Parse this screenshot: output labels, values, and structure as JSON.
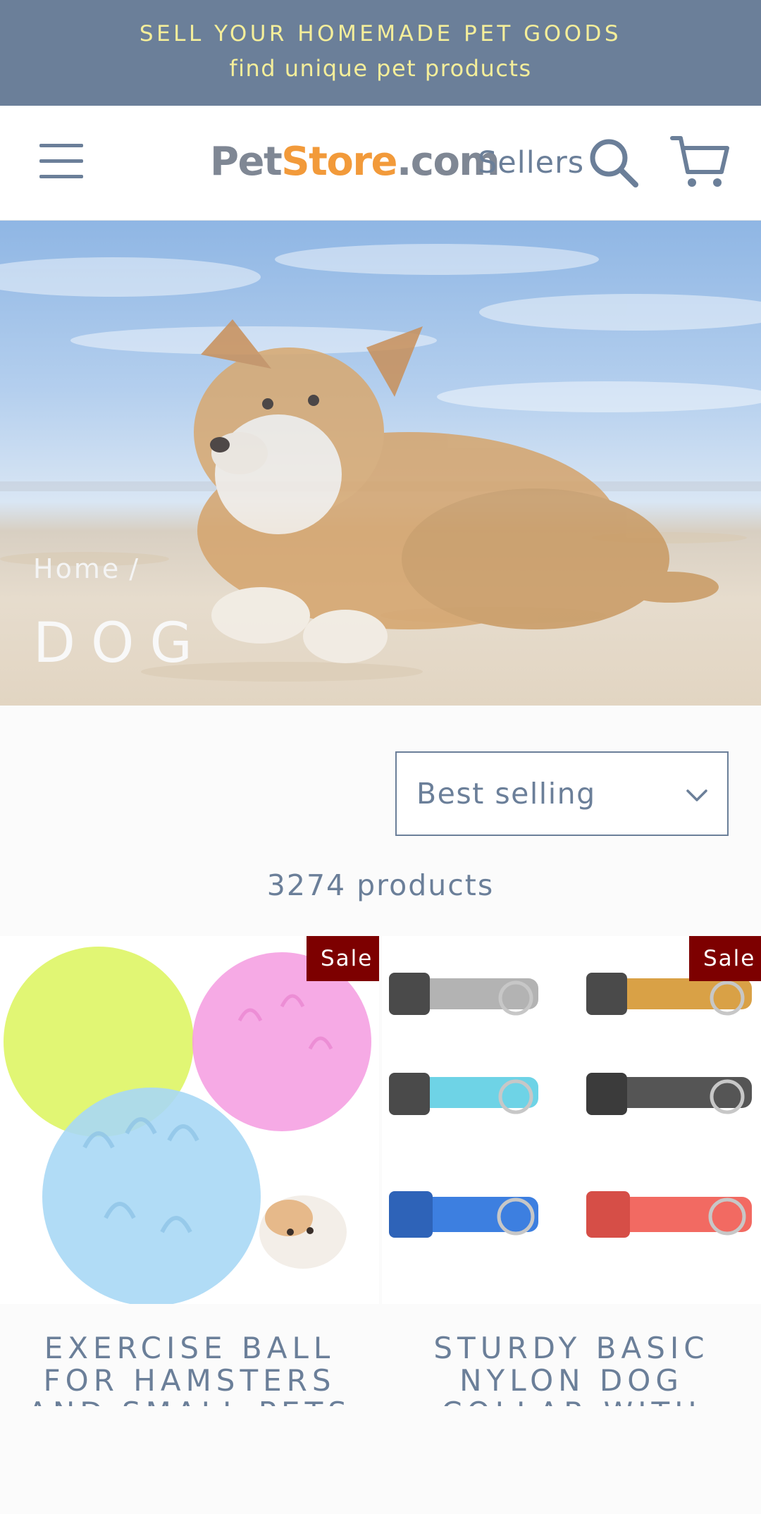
{
  "announcement": {
    "line1": "SELL YOUR HOMEMADE PET GOODS",
    "line2": "find unique pet products"
  },
  "header": {
    "logo_pet": "Pet",
    "logo_store": "Store",
    "logo_dotcom": ".com",
    "sellers_label": "Sellers",
    "icons": [
      "menu-icon",
      "search-icon",
      "cart-icon"
    ]
  },
  "hero": {
    "breadcrumb_home": "Home",
    "breadcrumb_sep": "/",
    "title": "DOG"
  },
  "sort": {
    "selected": "Best selling"
  },
  "product_count": "3274 products",
  "products": [
    {
      "name": "EXERCISE BALL FOR HAMSTERS AND SMALL PETS",
      "badge": "Sale"
    },
    {
      "name": "STURDY BASIC NYLON DOG COLLAR WITH",
      "badge": "Sale"
    }
  ],
  "colors": {
    "announcement_bg": "#6b7f99",
    "announcement_text": "#f4ee9a",
    "brand_text": "#6b7f99",
    "logo_accent": "#f29a3a",
    "sale_badge": "#7d0000"
  }
}
